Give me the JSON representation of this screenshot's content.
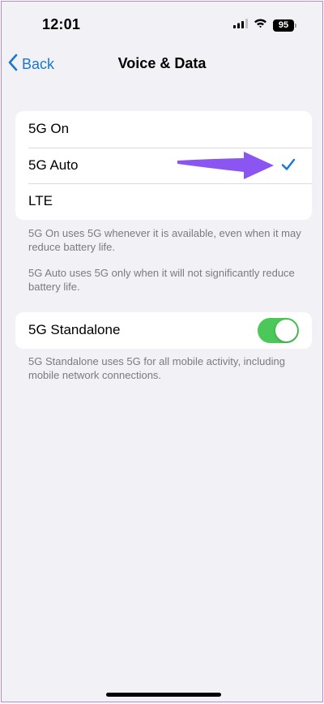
{
  "status_bar": {
    "time": "12:01",
    "battery": "95",
    "signal_icon": "cellular-signal-icon",
    "wifi_icon": "wifi-icon"
  },
  "nav": {
    "back_label": "Back",
    "title": "Voice & Data"
  },
  "network_options": {
    "items": [
      "5G On",
      "5G Auto",
      "LTE"
    ],
    "selected": "5G Auto"
  },
  "footnotes": {
    "five_g_on": "5G On uses 5G whenever it is available, even when it may reduce battery life.",
    "five_g_auto": "5G Auto uses 5G only when it will not significantly reduce battery life."
  },
  "standalone": {
    "label": "5G Standalone",
    "enabled": true,
    "footnote": "5G Standalone uses 5G for all mobile activity, including mobile network connections."
  },
  "colors": {
    "accent": "#1877d2",
    "toggle_on": "#4cc759",
    "annotation_arrow": "#8a55f0"
  }
}
